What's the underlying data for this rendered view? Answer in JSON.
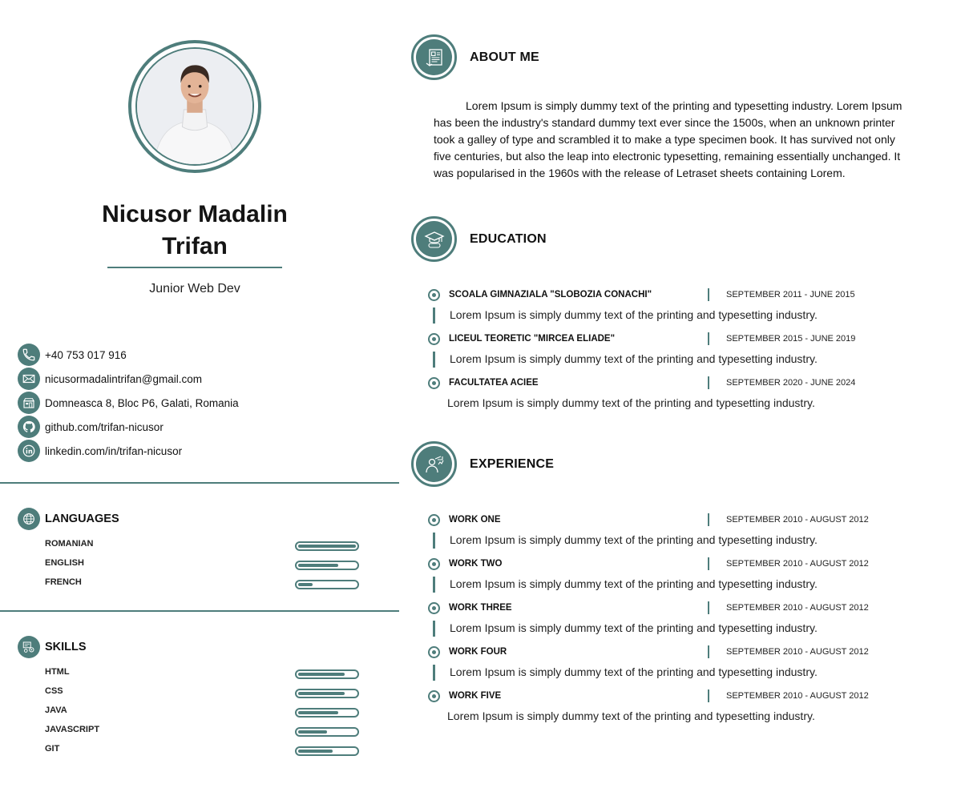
{
  "profile": {
    "name": "Nicusor Madalin Trifan",
    "role": "Junior Web Dev"
  },
  "contacts": [
    {
      "icon": "phone-icon",
      "text": "+40 753 017 916"
    },
    {
      "icon": "mail-icon",
      "text": "nicusormadalintrifan@gmail.com"
    },
    {
      "icon": "address-icon",
      "text": "Domneasca 8, Bloc P6, Galati, Romania"
    },
    {
      "icon": "github-icon",
      "text": "github.com/trifan-nicusor"
    },
    {
      "icon": "linkedin-icon",
      "text": "linkedin.com/in/trifan-nicusor"
    }
  ],
  "languages": {
    "title": "LANGUAGES",
    "icon": "globe-icon",
    "items": [
      {
        "label": "ROMANIAN",
        "level": 1.0
      },
      {
        "label": "ENGLISH",
        "level": 0.7
      },
      {
        "label": "FRENCH",
        "level": 0.25
      }
    ]
  },
  "skills": {
    "title": "SKILLS",
    "icon": "skills-icon",
    "items": [
      {
        "label": "HTML",
        "level": 0.8
      },
      {
        "label": "CSS",
        "level": 0.8
      },
      {
        "label": "JAVA",
        "level": 0.7
      },
      {
        "label": "JAVASCRIPT",
        "level": 0.5
      },
      {
        "label": "GIT",
        "level": 0.6
      }
    ]
  },
  "about": {
    "title": "ABOUT ME",
    "icon": "resume-icon",
    "text": "Lorem Ipsum is simply dummy text of the printing and typesetting industry. Lorem Ipsum has been the industry's standard dummy text ever since the 1500s, when an unknown printer took a galley of type and scrambled it to make a type specimen book. It has survived not only five centuries, but also the leap into electronic typesetting, remaining essentially unchanged. It was popularised in the 1960s with the release of Letraset sheets containing Lorem."
  },
  "education": {
    "title": "EDUCATION",
    "icon": "graduation-cap-icon",
    "items": [
      {
        "title": "SCOALA GIMNAZIALA \"SLOBOZIA CONACHI\"",
        "date": "SEPTEMBER 2011 - JUNE 2015",
        "desc": "Lorem Ipsum is simply dummy text of the printing and typesetting industry."
      },
      {
        "title": "LICEUL TEORETIC \"MIRCEA ELIADE\"",
        "date": "SEPTEMBER 2015 - JUNE 2019",
        "desc": "Lorem Ipsum is simply dummy text of the printing and typesetting industry."
      },
      {
        "title": "FACULTATEA ACIEE",
        "date": "SEPTEMBER 2020 - JUNE 2024",
        "desc": "Lorem Ipsum is simply dummy text of the printing and typesetting industry."
      }
    ]
  },
  "experience": {
    "title": "EXPERIENCE",
    "icon": "presenter-icon",
    "items": [
      {
        "title": "WORK ONE",
        "date": "SEPTEMBER 2010 - AUGUST 2012",
        "desc": "Lorem Ipsum is simply dummy text of the printing and typesetting industry."
      },
      {
        "title": "WORK TWO",
        "date": "SEPTEMBER 2010 - AUGUST 2012",
        "desc": "Lorem Ipsum is simply dummy text of the printing and typesetting industry."
      },
      {
        "title": "WORK THREE",
        "date": "SEPTEMBER 2010 - AUGUST 2012",
        "desc": "Lorem Ipsum is simply dummy text of the printing and typesetting industry."
      },
      {
        "title": "WORK FOUR",
        "date": "SEPTEMBER 2010 - AUGUST 2012",
        "desc": "Lorem Ipsum is simply dummy text of the printing and typesetting industry."
      },
      {
        "title": "WORK FIVE",
        "date": "SEPTEMBER 2010 - AUGUST 2012",
        "desc": "Lorem Ipsum is simply dummy text of the printing and typesetting industry."
      }
    ]
  },
  "colors": {
    "accent": "#4e7d7b"
  }
}
